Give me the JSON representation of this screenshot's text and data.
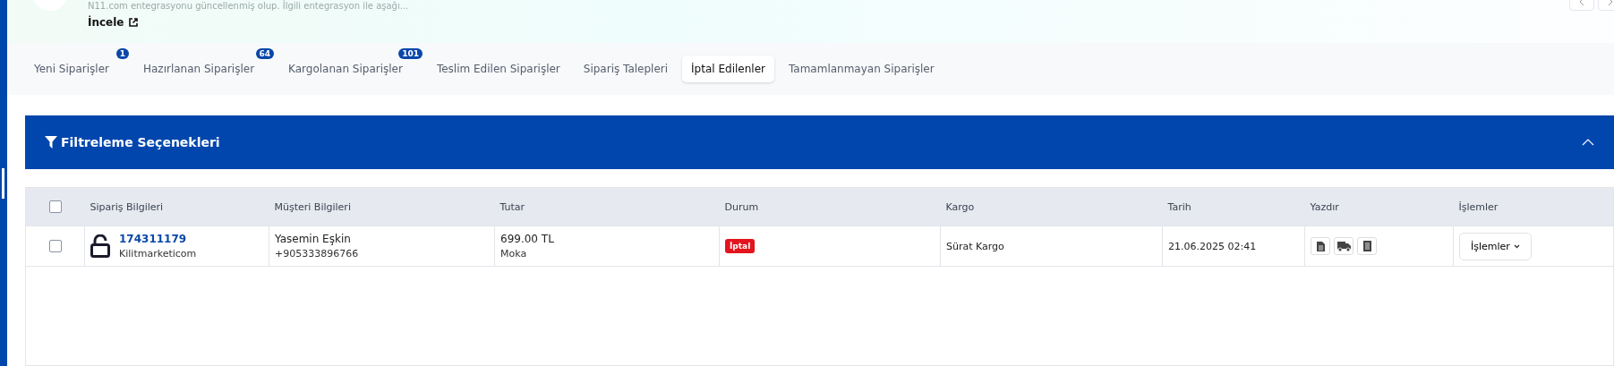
{
  "notice": {
    "text": "N11.com entegrasyonu güncellenmiş olup. İlgili entegrasyon ile aşağı...",
    "link": "İncele"
  },
  "tabs": [
    {
      "label": "Yeni Siparişler",
      "badge": "1",
      "selected": false
    },
    {
      "label": "Hazırlanan Siparişler",
      "badge": "64",
      "selected": false
    },
    {
      "label": "Kargolanan Siparişler",
      "badge": "101",
      "selected": false
    },
    {
      "label": "Teslim Edilen Siparişler",
      "selected": false
    },
    {
      "label": "Sipariş Talepleri",
      "selected": false
    },
    {
      "label": "İptal Edilenler",
      "selected": true
    },
    {
      "label": "Tamamlanmayan Siparişler",
      "selected": false
    }
  ],
  "filter": {
    "title": "Filtreleme Seçenekleri",
    "expanded": true
  },
  "table": {
    "select_all": {
      "checked": false
    },
    "columns": [
      "Sipariş Bilgileri",
      "Müşteri Bilgileri",
      "Tutar",
      "Durum",
      "Kargo",
      "Tarih",
      "Yazdır",
      "İşlemler"
    ],
    "rows": [
      {
        "checked": false,
        "order_no": "174311179",
        "store": "Kilitmarketicom",
        "customer": "Yasemin Eşkin",
        "phone": "+905333896766",
        "amount": "699.00 TL",
        "payment": "Moka",
        "status": {
          "label": "İptal",
          "color": "#e3141e"
        },
        "cargo": "Sürat Kargo",
        "date": "21.06.2025 02:41",
        "action": "İşlemler"
      }
    ]
  }
}
